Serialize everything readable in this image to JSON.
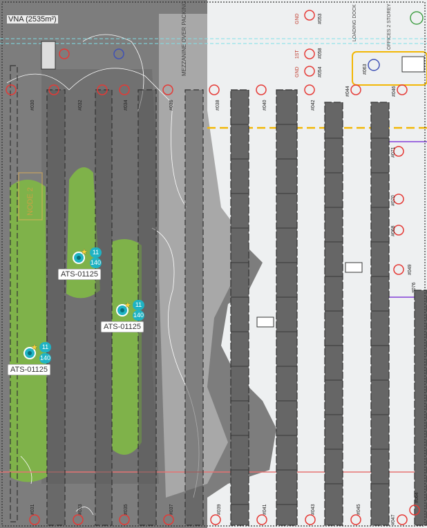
{
  "zone": {
    "label": "VNA (2535m²)"
  },
  "areas": {
    "mezzanine": "MEZZANINE OVER PACKING AREA",
    "loading": "LOADING DOCK",
    "offices": "OFFICES 2 STOREY",
    "node": "NODE 2"
  },
  "access_points": [
    {
      "name": "ATS-01125",
      "count_top": "11",
      "count_bottom": "140"
    },
    {
      "name": "ATS-01125",
      "count_top": "11",
      "count_bottom": "140"
    },
    {
      "name": "ATS-01125",
      "count_top": "11",
      "count_bottom": "140"
    }
  ],
  "rack_labels": [
    "#038",
    "#040",
    "#042",
    "#044",
    "#046",
    "#037",
    "#039",
    "#041",
    "#043",
    "#045",
    "#047",
    "#031",
    "#033",
    "#035",
    "#030",
    "#032",
    "#034",
    "#036"
  ],
  "floor_labels": [
    "GND",
    "1ST",
    "GND",
    "#053",
    "#058",
    "#054",
    "#063",
    "#070",
    "#068",
    "#071",
    "#049",
    "#076",
    "#064"
  ],
  "colors": {
    "coverage_strong": "#7fb24a",
    "coverage_medium": "#8a8a8a",
    "coverage_weak": "#b5b5b5",
    "accent_red": "#e53935",
    "accent_yellow": "#f2b705",
    "ap": "#1fb3c4"
  }
}
